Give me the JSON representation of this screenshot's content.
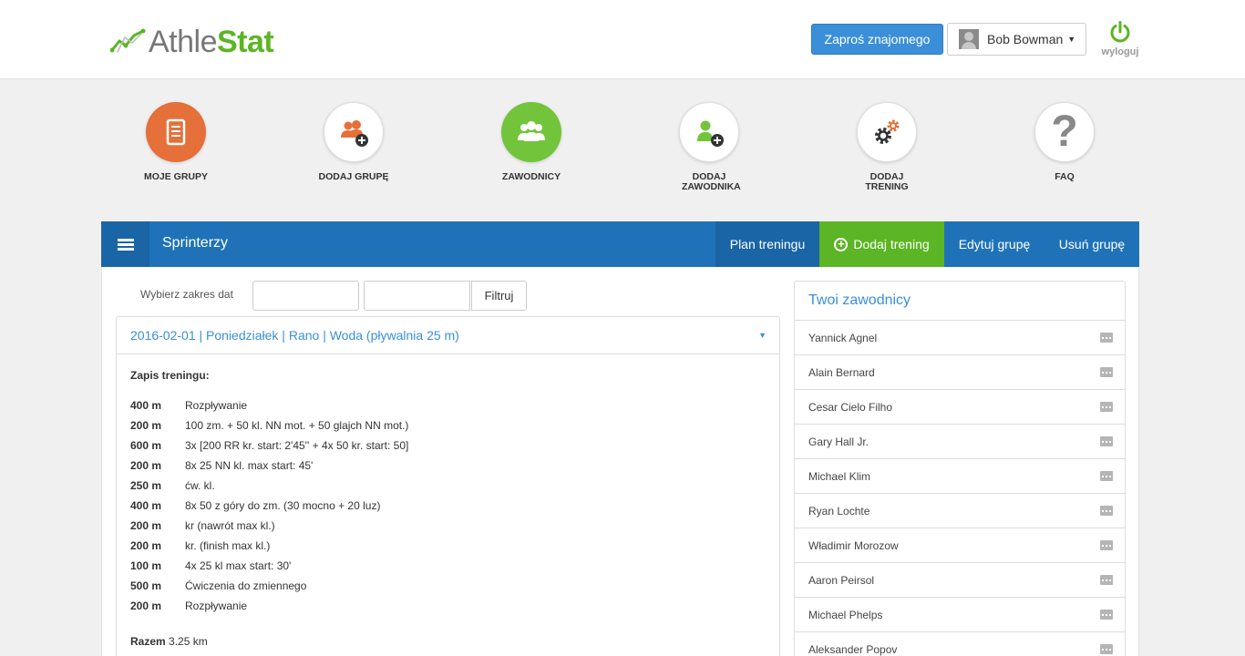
{
  "header": {
    "logo_part1": "Athle",
    "logo_part2": "Stat",
    "invite_button": "Zaproś znajomego",
    "user_name": "Bob Bowman",
    "logout_label": "wyloguj"
  },
  "nav": [
    {
      "label": "MOJE GRUPY",
      "icon": "list-icon"
    },
    {
      "label": "DODAJ GRUPĘ",
      "icon": "add-group-icon"
    },
    {
      "label": "ZAWODNICY",
      "icon": "athletes-icon"
    },
    {
      "label": "DODAJ ZAWODNIKA",
      "icon": "add-athlete-icon"
    },
    {
      "label": "DODAJ TRENING",
      "icon": "gears-icon"
    },
    {
      "label": "FAQ",
      "icon": "question-icon"
    }
  ],
  "group_bar": {
    "title": "Sprinterzy",
    "tabs": [
      "Plan treningu",
      "Dodaj trening",
      "Edytuj grupę",
      "Usuń grupę"
    ]
  },
  "filter": {
    "label": "Wybierz zakres dat",
    "button": "Filtruj"
  },
  "workout": {
    "header": "2016-02-01 | Poniedziałek | Rano | Woda (pływalnia 25 m)",
    "section_title": "Zapis treningu:",
    "rows": [
      {
        "dist": "400 m",
        "desc": "Rozpływanie"
      },
      {
        "dist": "200 m",
        "desc": "100 zm. + 50 kl. NN mot. + 50 glajch NN mot.)"
      },
      {
        "dist": "600 m",
        "desc": "3x [200 RR kr. start: 2'45'' + 4x 50 kr. start: 50]"
      },
      {
        "dist": "200 m",
        "desc": "8x 25 NN kl. max start: 45'"
      },
      {
        "dist": "250 m",
        "desc": "ćw. kl."
      },
      {
        "dist": "400 m",
        "desc": "8x 50 z góry do zm. (30 mocno + 20 luz)"
      },
      {
        "dist": "200 m",
        "desc": "kr (nawrót max kl.)"
      },
      {
        "dist": "200 m",
        "desc": "kr. (finish max kl.)"
      },
      {
        "dist": "100 m",
        "desc": "4x 25 kl max start: 30'"
      },
      {
        "dist": "500 m",
        "desc": "Ćwiczenia do zmiennego"
      },
      {
        "dist": "200 m",
        "desc": "Rozpływanie"
      }
    ],
    "total_label": "Razem",
    "total_value": "3.25 km"
  },
  "athletes": {
    "title": "Twoi zawodnicy",
    "list": [
      "Yannick Agnel",
      "Alain Bernard",
      "Cesar Cielo Filho",
      "Gary Hall Jr.",
      "Michael Klim",
      "Ryan Lochte",
      "Władimir Morozow",
      "Aaron Peirsol",
      "Michael Phelps",
      "Aleksander Popov"
    ]
  },
  "colors": {
    "brand_green": "#5cb524",
    "brand_blue": "#1f72b8",
    "accent_orange": "#e5703a",
    "link_blue": "#3a8fd8"
  }
}
